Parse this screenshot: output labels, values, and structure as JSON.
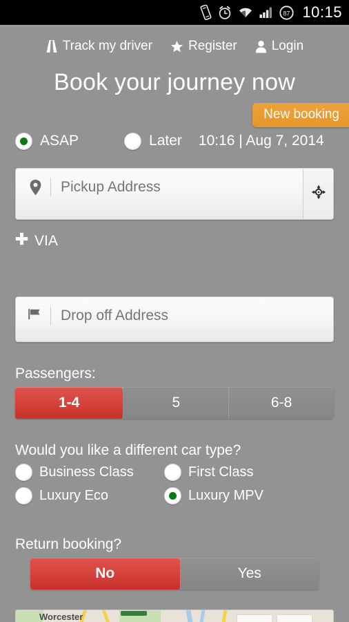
{
  "statusbar": {
    "time": "10:15",
    "battery_level": "87",
    "icons": [
      "vibrate-icon",
      "alarm-icon",
      "wifi-icon",
      "signal-icon",
      "battery-icon"
    ]
  },
  "topnav": {
    "items": [
      {
        "label": "Track my driver",
        "icon": "road-icon"
      },
      {
        "label": "Register",
        "icon": "star-icon"
      },
      {
        "label": "Login",
        "icon": "person-icon"
      }
    ]
  },
  "header": {
    "title": "Book your journey now",
    "new_booking_label": "New booking"
  },
  "when": {
    "asap_label": "ASAP",
    "later_label": "Later",
    "datetime": "10:16 | Aug 7, 2014",
    "selected": "ASAP"
  },
  "pickup": {
    "placeholder": "Pickup Address",
    "value": "",
    "icon": "map-pin-icon",
    "locate_icon": "locate-crosshair-icon"
  },
  "via": {
    "label": "VIA",
    "icon": "plus-icon"
  },
  "dropoff": {
    "placeholder": "Drop off Address",
    "value": "",
    "icon": "flag-icon"
  },
  "passengers": {
    "label": "Passengers:",
    "options": [
      "1-4",
      "5",
      "6-8"
    ],
    "selected": "1-4"
  },
  "cartype": {
    "question": "Would you like a different car type?",
    "options": [
      {
        "label": "Business Class",
        "selected": false
      },
      {
        "label": "First Class",
        "selected": false
      },
      {
        "label": "Luxury Eco",
        "selected": false
      },
      {
        "label": "Luxury MPV",
        "selected": true
      }
    ]
  },
  "return_booking": {
    "label": "Return booking?",
    "options": [
      "No",
      "Yes"
    ],
    "selected": "No"
  },
  "map": {
    "place_label": "Worcester"
  },
  "colors": {
    "background": "#939393",
    "accent_red": "#d6433c",
    "accent_orange": "#e8952b",
    "radio_green": "#0a7a17",
    "text_white": "#ffffff",
    "placeholder_gray": "#9b9b9b"
  }
}
